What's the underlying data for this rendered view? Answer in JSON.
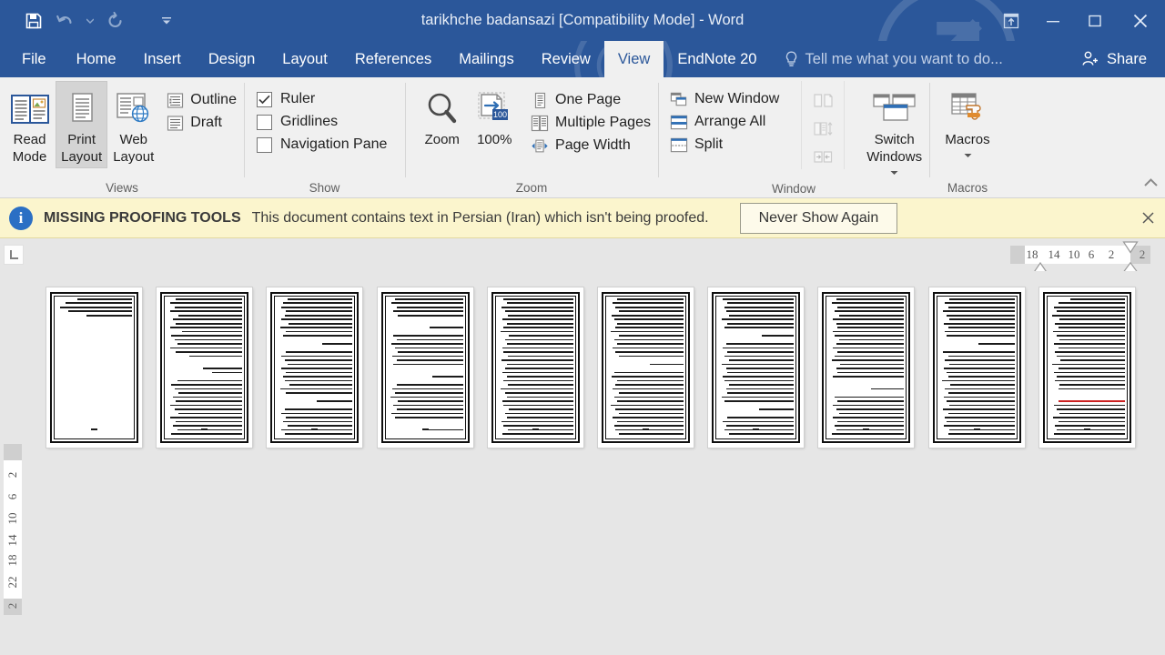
{
  "window": {
    "title": "tarikhche badansazi [Compatibility Mode] - Word",
    "accent_color": "#2b579a",
    "quick_access": [
      {
        "name": "save-button",
        "icon": "save-icon",
        "label": "Save"
      },
      {
        "name": "undo-button",
        "icon": "undo-icon",
        "label": "Undo"
      },
      {
        "name": "redo-button",
        "icon": "redo-icon",
        "label": "Redo"
      }
    ],
    "customize_qat_label": "Customize Quick Access Toolbar",
    "controls": [
      {
        "name": "ribbon-display-options-button",
        "icon": "ribbon-display-icon",
        "label": "Ribbon Display Options"
      },
      {
        "name": "minimize-button",
        "icon": "minimize-icon",
        "label": "Minimize"
      },
      {
        "name": "maximize-button",
        "icon": "maximize-icon",
        "label": "Restore Down"
      },
      {
        "name": "close-button",
        "icon": "close-icon",
        "label": "Close"
      }
    ]
  },
  "tabs": [
    {
      "label": "File",
      "active": false
    },
    {
      "label": "Home",
      "active": false
    },
    {
      "label": "Insert",
      "active": false
    },
    {
      "label": "Design",
      "active": false
    },
    {
      "label": "Layout",
      "active": false
    },
    {
      "label": "References",
      "active": false
    },
    {
      "label": "Mailings",
      "active": false
    },
    {
      "label": "Review",
      "active": false
    },
    {
      "label": "View",
      "active": true
    },
    {
      "label": "EndNote 20",
      "active": false
    }
  ],
  "tellme": {
    "placeholder": "Tell me what you want to do...",
    "icon": "lightbulb-icon"
  },
  "share": {
    "label": "Share",
    "icon": "share-person-icon"
  },
  "ribbon": {
    "collapse_label": "Collapse the Ribbon",
    "groups": [
      {
        "name": "views",
        "label": "Views",
        "buttons": [
          {
            "name": "read-mode-button",
            "label": "Read\nMode",
            "icon": "read-mode-icon",
            "selected": false
          },
          {
            "name": "print-layout-button",
            "label": "Print\nLayout",
            "icon": "print-layout-icon",
            "selected": true
          },
          {
            "name": "web-layout-button",
            "label": "Web\nLayout",
            "icon": "web-layout-icon",
            "selected": false
          }
        ],
        "small_items": [
          {
            "name": "outline-button",
            "label": "Outline",
            "icon": "outline-icon"
          },
          {
            "name": "draft-button",
            "label": "Draft",
            "icon": "draft-icon"
          }
        ]
      },
      {
        "name": "show",
        "label": "Show",
        "checkboxes": [
          {
            "name": "ruler-checkbox",
            "label": "Ruler",
            "checked": true
          },
          {
            "name": "gridlines-checkbox",
            "label": "Gridlines",
            "checked": false
          },
          {
            "name": "navigation-pane-checkbox",
            "label": "Navigation Pane",
            "checked": false
          }
        ]
      },
      {
        "name": "zoom",
        "label": "Zoom",
        "buttons": [
          {
            "name": "zoom-button",
            "label": "Zoom",
            "icon": "magnifier-icon",
            "selected": false
          },
          {
            "name": "zoom-100-button",
            "label": "100%",
            "icon": "zoom-100-icon",
            "selected": false
          }
        ],
        "small_items": [
          {
            "name": "one-page-button",
            "label": "One Page",
            "icon": "one-page-icon"
          },
          {
            "name": "multiple-pages-button",
            "label": "Multiple Pages",
            "icon": "multiple-pages-icon"
          },
          {
            "name": "page-width-button",
            "label": "Page Width",
            "icon": "page-width-icon"
          }
        ]
      },
      {
        "name": "window",
        "label": "Window",
        "small_items": [
          {
            "name": "new-window-button",
            "label": "New Window",
            "icon": "new-window-icon"
          },
          {
            "name": "arrange-all-button",
            "label": "Arrange All",
            "icon": "arrange-all-icon"
          },
          {
            "name": "split-button",
            "label": "Split",
            "icon": "split-icon"
          }
        ],
        "disabled_icons": [
          {
            "name": "view-side-by-side-button",
            "icon": "view-side-by-side-icon",
            "label": "View Side by Side"
          },
          {
            "name": "synchronous-scrolling-button",
            "icon": "synchronous-scrolling-icon",
            "label": "Synchronous Scrolling"
          },
          {
            "name": "reset-window-position-button",
            "icon": "reset-window-position-icon",
            "label": "Reset Window Position"
          }
        ],
        "buttons": [
          {
            "name": "switch-windows-button",
            "label": "Switch\nWindows",
            "icon": "switch-windows-icon",
            "has_caret": true
          }
        ]
      },
      {
        "name": "macros",
        "label": "Macros",
        "buttons": [
          {
            "name": "macros-button",
            "label": "Macros",
            "icon": "macros-icon",
            "has_caret": true
          }
        ]
      }
    ]
  },
  "message_bar": {
    "icon": "info-icon",
    "title": "MISSING PROOFING TOOLS",
    "text": "This document contains text in Persian (Iran) which isn't being proofed.",
    "button_label": "Never Show Again",
    "close_label": "Close",
    "background": "#fbf5cd"
  },
  "ruler": {
    "tab_selector_glyph": "L",
    "tab_selector_label": "Left Tab",
    "horizontal_numbers": [
      "18",
      "14",
      "10",
      "6",
      "2",
      "2"
    ],
    "vertical_numbers": [
      "2",
      "2",
      "6",
      "10",
      "14",
      "18",
      "22"
    ],
    "left_indent_label": "Left Indent",
    "right_indent_label": "Right Indent"
  },
  "document": {
    "zoom_level": "100%",
    "view_mode": "Multiple Pages",
    "page_count": 10,
    "pages": [
      {
        "index": 1,
        "lines": [
          72,
          88,
          95,
          84,
          60,
          0,
          0,
          0,
          0,
          0,
          0,
          0,
          0,
          0,
          0,
          0,
          0,
          0,
          0,
          0,
          0,
          0,
          0,
          0,
          0,
          0,
          0,
          0,
          0,
          0,
          0,
          0,
          0,
          0,
          0,
          0,
          0,
          0,
          0,
          0
        ],
        "numbered": true
      },
      {
        "index": 2,
        "lines": [
          88,
          95,
          90,
          96,
          85,
          92,
          88,
          96,
          80,
          94,
          90,
          86,
          95,
          88,
          70,
          0,
          0,
          52,
          40,
          0,
          86,
          94,
          90,
          85,
          92,
          88,
          95,
          90,
          84,
          96,
          88,
          92,
          86,
          94,
          90,
          88,
          95,
          82,
          90,
          60
        ],
        "numbered": true
      },
      {
        "index": 3,
        "lines": [
          86,
          92,
          95,
          88,
          90,
          94,
          85,
          96,
          88,
          92,
          0,
          40,
          0,
          88,
          94,
          90,
          86,
          95,
          88,
          92,
          90,
          84,
          96,
          88,
          0,
          48,
          0,
          90,
          94,
          88,
          92,
          86,
          95,
          90,
          88,
          94,
          86,
          92,
          88,
          66
        ],
        "numbered": true
      },
      {
        "index": 4,
        "lines": [
          90,
          95,
          88,
          92,
          86,
          0,
          0,
          44,
          0,
          92,
          88,
          95,
          90,
          86,
          94,
          88,
          92,
          0,
          0,
          40,
          0,
          88,
          94,
          90,
          96,
          86,
          92,
          88,
          95,
          90,
          0,
          0,
          46,
          0,
          92,
          88,
          94,
          90,
          86,
          70
        ],
        "numbered": true
      },
      {
        "index": 5,
        "lines": [
          92,
          88,
          95,
          90,
          86,
          94,
          88,
          92,
          96,
          85,
          90,
          88,
          94,
          92,
          86,
          95,
          88,
          90,
          94,
          88,
          92,
          86,
          96,
          90,
          88,
          94,
          92,
          85,
          90,
          88,
          95,
          92,
          86,
          94,
          88,
          90,
          92,
          88,
          86,
          74
        ],
        "numbered": true
      },
      {
        "index": 6,
        "lines": [
          88,
          94,
          90,
          86,
          95,
          92,
          88,
          90,
          96,
          85,
          92,
          88,
          94,
          90,
          86,
          0,
          44,
          0,
          92,
          95,
          88,
          90,
          94,
          86,
          92,
          88,
          96,
          90,
          85,
          94,
          88,
          92,
          90,
          86,
          95,
          88,
          92,
          90,
          88,
          68
        ],
        "numbered": true
      },
      {
        "index": 7,
        "lines": [
          94,
          88,
          92,
          90,
          86,
          95,
          88,
          92,
          0,
          42,
          0,
          90,
          94,
          88,
          92,
          86,
          96,
          90,
          88,
          94,
          92,
          86,
          90,
          88,
          95,
          92,
          0,
          46,
          0,
          88,
          94,
          90,
          92,
          86,
          95,
          88,
          90,
          94,
          88,
          72
        ],
        "numbered": true
      },
      {
        "index": 8,
        "lines": [
          90,
          96,
          88,
          92,
          86,
          94,
          90,
          88,
          95,
          92,
          86,
          90,
          94,
          88,
          92,
          96,
          85,
          90,
          88,
          94,
          0,
          0,
          44,
          0,
          92,
          88,
          95,
          90,
          86,
          94,
          88,
          92,
          90,
          96,
          85,
          88,
          94,
          90,
          86,
          64
        ],
        "numbered": true
      },
      {
        "index": 9,
        "lines": [
          86,
          92,
          88,
          95,
          90,
          86,
          94,
          88,
          92,
          90,
          0,
          48,
          0,
          95,
          88,
          92,
          86,
          94,
          90,
          88,
          96,
          85,
          92,
          88,
          94,
          90,
          86,
          95,
          88,
          92,
          90,
          94,
          86,
          88,
          92,
          90,
          95,
          88,
          86,
          70
        ],
        "numbered": true
      },
      {
        "index": 10,
        "lines": [
          72,
          88,
          94,
          90,
          96,
          86,
          92,
          88,
          95,
          90,
          86,
          94,
          88,
          92,
          90,
          85,
          96,
          88,
          94,
          90,
          92,
          86,
          88,
          0,
          0,
          88,
          94,
          90,
          86,
          95,
          88,
          92,
          90,
          94,
          86,
          88,
          92,
          90,
          95,
          66
        ],
        "numbered": true,
        "red_line_index": 25
      }
    ]
  }
}
